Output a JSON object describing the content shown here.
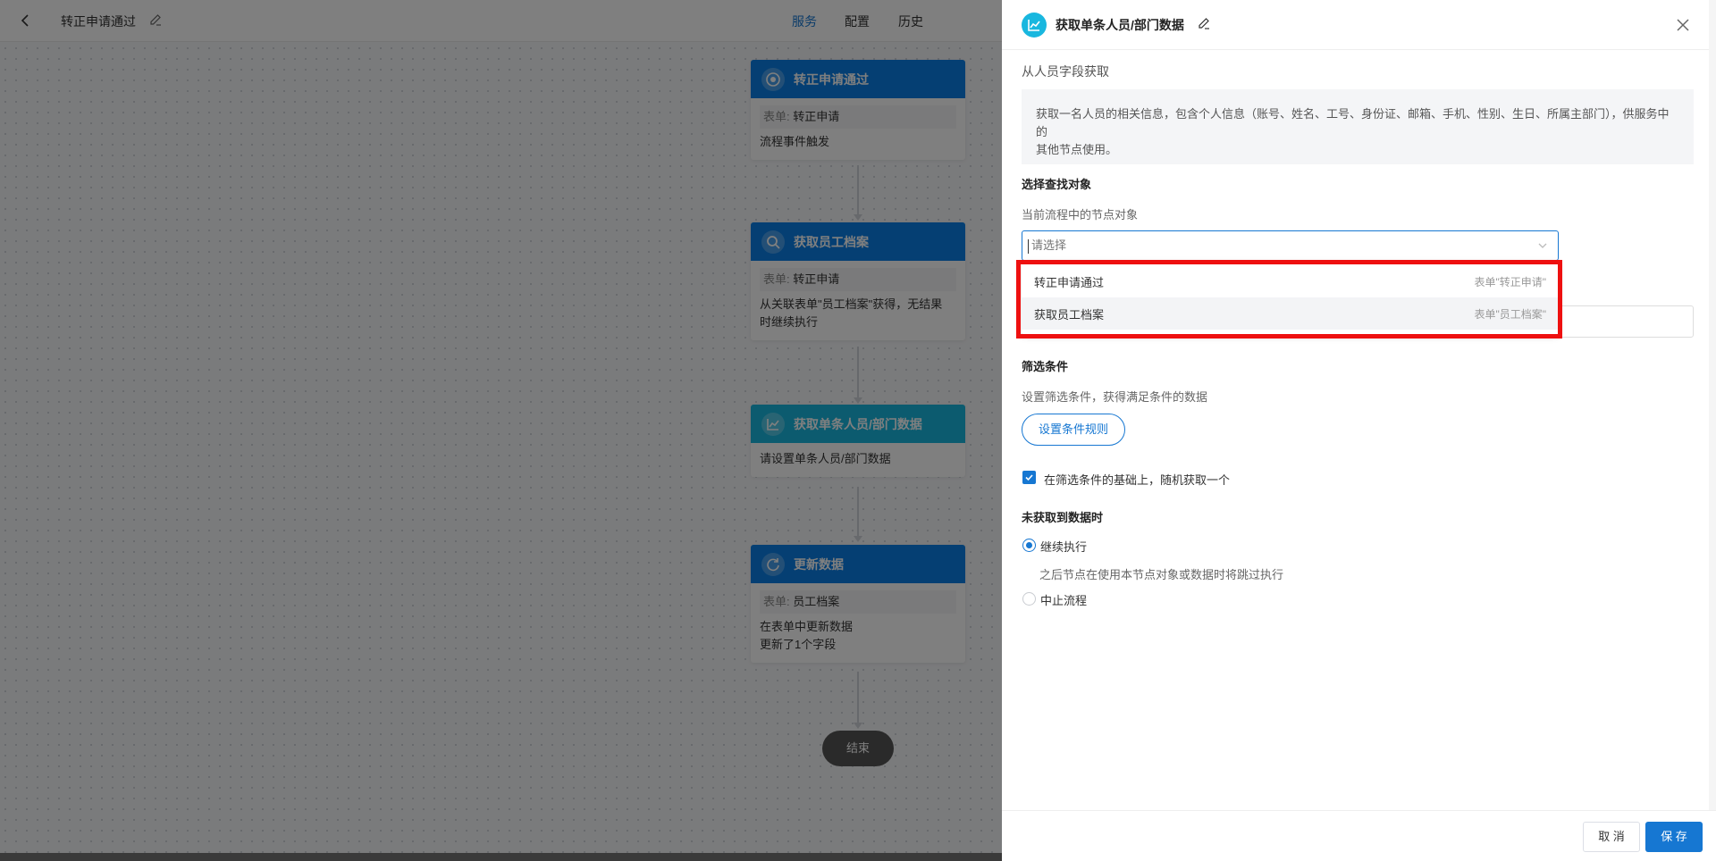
{
  "topbar": {
    "flow_title": "转正申请通过",
    "tabs": [
      {
        "label": "服务",
        "active": true
      },
      {
        "label": "配置",
        "active": false
      },
      {
        "label": "历史",
        "active": false
      }
    ]
  },
  "flow": {
    "nodes": [
      {
        "title": "转正申请通过",
        "icon": "target-icon",
        "color": "#0a7fe6",
        "tag_key": "表单:",
        "tag_value": "转正申请",
        "lines": [
          "流程事件触发"
        ]
      },
      {
        "title": "获取员工档案",
        "icon": "search-icon",
        "color": "#0a7fe6",
        "tag_key": "表单:",
        "tag_value": "转正申请",
        "lines": [
          "从关联表单\"员工档案\"获得，无结果",
          "时继续执行"
        ]
      },
      {
        "title": "获取单条人员/部门数据",
        "icon": "chart-line-icon",
        "color": "#19b7df",
        "lines": [
          "请设置单条人员/部门数据"
        ]
      },
      {
        "title": "更新数据",
        "icon": "refresh-icon",
        "color": "#0a7fe6",
        "tag_key": "表单:",
        "tag_value": "员工档案",
        "lines": [
          "在表单中更新数据",
          "更新了1个字段"
        ]
      }
    ],
    "end_label": "结束"
  },
  "panel": {
    "title": "获取单条人员/部门数据",
    "icon": "chart-line-icon",
    "source": "从人员字段获取",
    "description_line1": "获取一名人员的相关信息，包含个人信息（账号、姓名、工号、身份证、邮箱、手机、性别、生日、所属主部门），供服务中的",
    "description_line2": "其他节点使用。",
    "target_section": {
      "title": "选择查找对象",
      "subtitle": "当前流程中的节点对象",
      "placeholder": "请选择",
      "options": [
        {
          "label": "转正申请通过",
          "hint": "表单\"转正申请\""
        },
        {
          "label": "获取员工档案",
          "hint": "表单\"员工档案\""
        }
      ]
    },
    "filter_section": {
      "title": "筛选条件",
      "subtitle": "设置筛选条件，获得满足条件的数据",
      "rule_button": "设置条件规则",
      "random_label": "在筛选条件的基础上，随机获取一个",
      "random_checked": true
    },
    "nodata_section": {
      "title": "未获取到数据时",
      "option_continue": "继续执行",
      "continue_hint": "之后节点在使用本节点对象或数据时将跳过执行",
      "option_stop": "中止流程",
      "selected": "继续执行"
    },
    "footer": {
      "cancel": "取 消",
      "save": "保 存"
    }
  },
  "colors": {
    "primary": "#1677d2",
    "node_blue": "#0a7fe6",
    "node_cyan": "#19b7df",
    "highlight": "#ee1010"
  }
}
